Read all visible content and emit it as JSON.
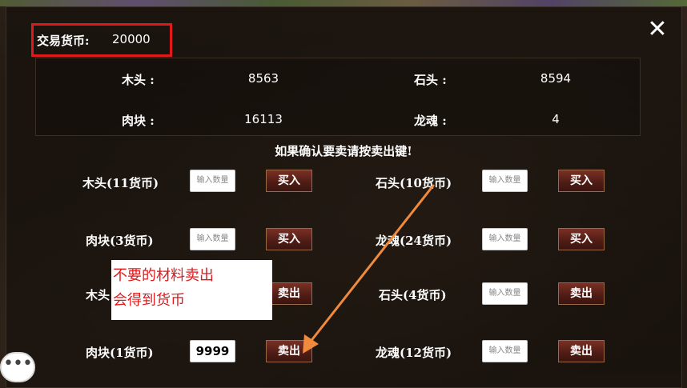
{
  "header": {
    "currency_label": "交易货币:",
    "currency_value": "20000",
    "close_icon": "close-icon"
  },
  "stats": {
    "wood_label": "木头 :",
    "wood_value": "8563",
    "stone_label": "石头 :",
    "stone_value": "8594",
    "meat_label": "肉块 :",
    "meat_value": "16113",
    "dragon_label": "龙魂 :",
    "dragon_value": "4"
  },
  "confirm_text": "如果确认要卖请按卖出键!",
  "buy": {
    "wood_label": "木头(11货币)",
    "stone_label": "石头(10货币)",
    "meat_label": "肉块(3货币)",
    "dragon_label": "龙魂(24货币)",
    "button_label": "买入"
  },
  "sell": {
    "wood_label": "木头",
    "stone_label": "石头(4货币)",
    "meat_label": "肉块(1货币)",
    "dragon_label": "龙魂(12货币)",
    "button_label": "卖出",
    "meat_qty_value": "9999"
  },
  "qty_placeholder": "输入数量",
  "annotation": {
    "line1": "不要的材料卖出",
    "line2": "会得到货币",
    "highlight_color": "#e0191b",
    "arrow_color": "#f08a3c"
  },
  "chat_icon": "chat-bubble-icon"
}
